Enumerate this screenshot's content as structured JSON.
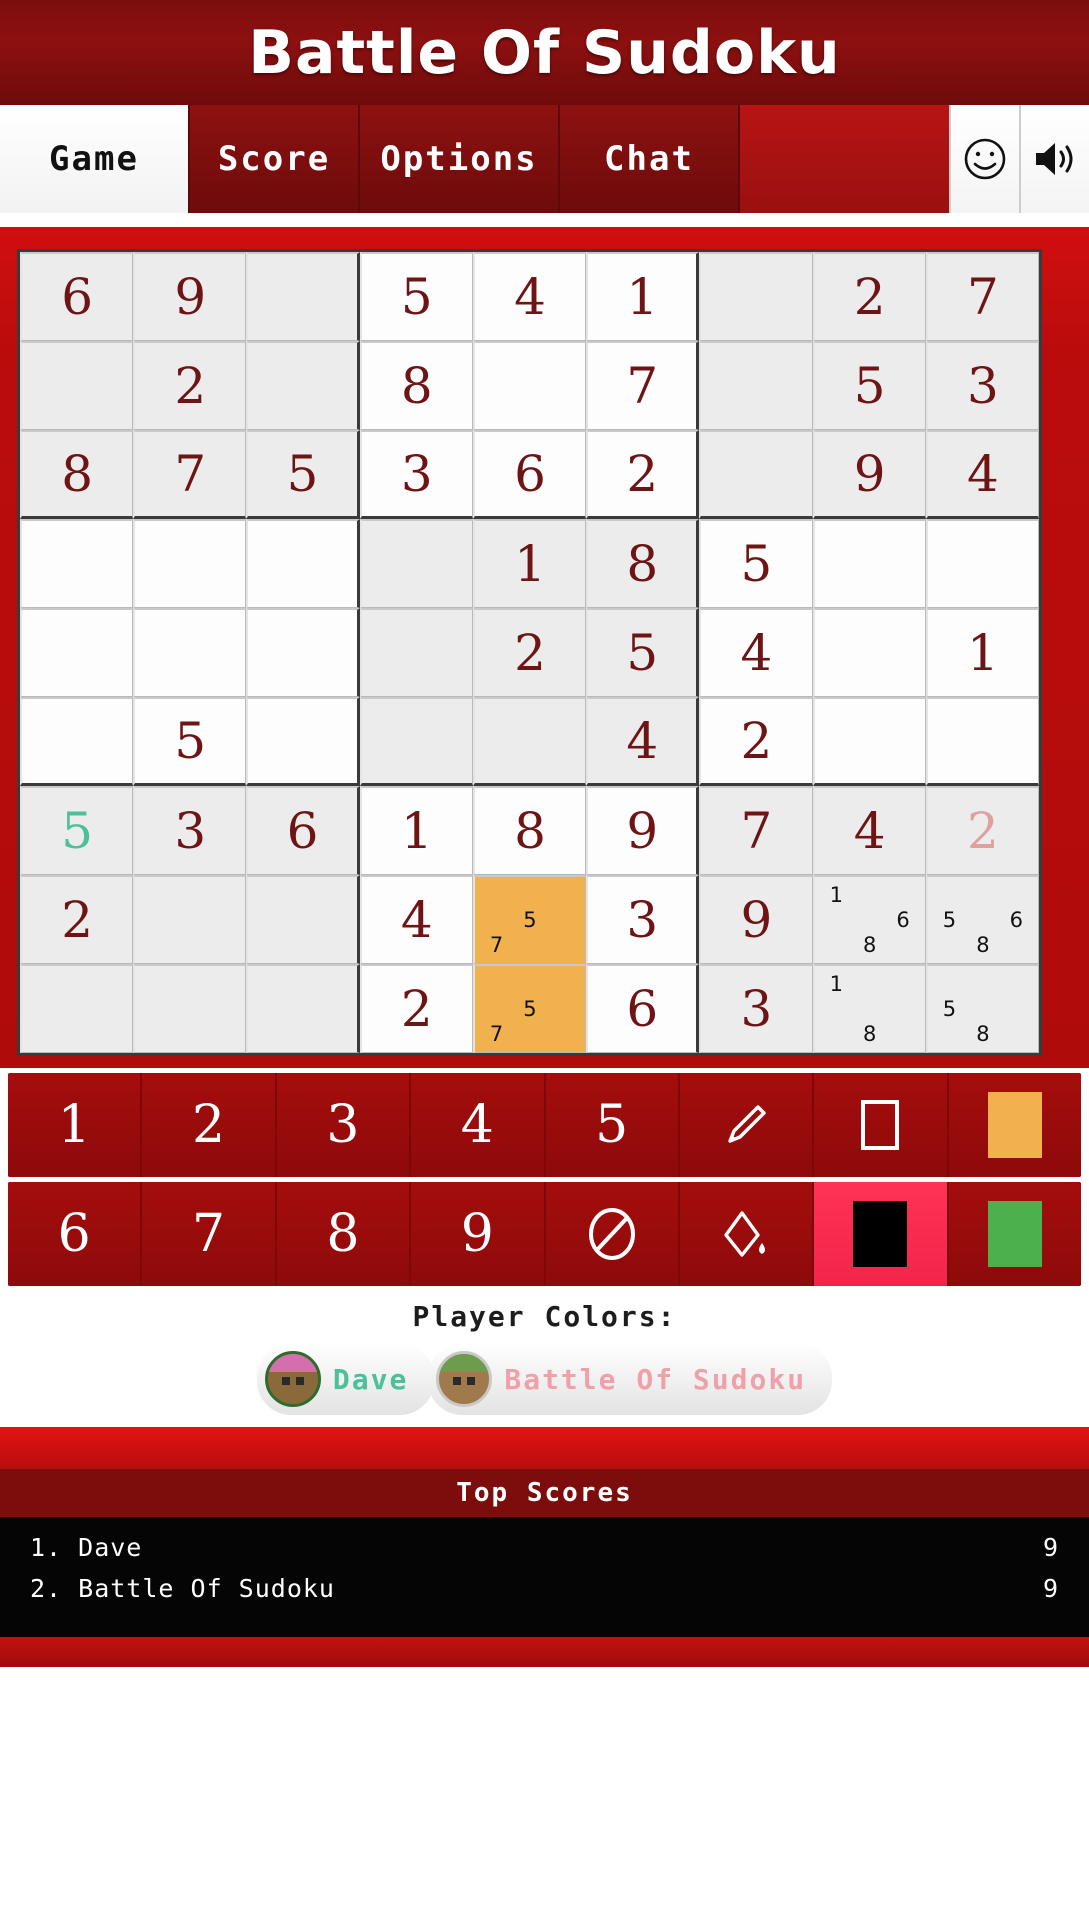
{
  "header": {
    "title": "Battle Of Sudoku"
  },
  "tabs": [
    {
      "label": "Game",
      "active": true
    },
    {
      "label": "Score",
      "active": false
    },
    {
      "label": "Options",
      "active": false
    },
    {
      "label": "Chat",
      "active": false
    }
  ],
  "tab_icons": [
    {
      "name": "smiley-icon"
    },
    {
      "name": "speaker-icon"
    }
  ],
  "board": {
    "rows": [
      [
        {
          "v": "6",
          "s": "given"
        },
        {
          "v": "9",
          "s": "given"
        },
        {
          "v": "",
          "s": "given"
        },
        {
          "v": "5",
          "s": "given"
        },
        {
          "v": "4",
          "s": "given"
        },
        {
          "v": "1",
          "s": "given"
        },
        {
          "v": "",
          "s": "given"
        },
        {
          "v": "2",
          "s": "given"
        },
        {
          "v": "7",
          "s": "given"
        }
      ],
      [
        {
          "v": "",
          "s": "given"
        },
        {
          "v": "2",
          "s": "given"
        },
        {
          "v": "",
          "s": "given"
        },
        {
          "v": "8",
          "s": "given"
        },
        {
          "v": "",
          "s": "given"
        },
        {
          "v": "7",
          "s": "given"
        },
        {
          "v": "",
          "s": "given"
        },
        {
          "v": "5",
          "s": "given"
        },
        {
          "v": "3",
          "s": "given"
        }
      ],
      [
        {
          "v": "8",
          "s": "given"
        },
        {
          "v": "7",
          "s": "given"
        },
        {
          "v": "5",
          "s": "given"
        },
        {
          "v": "3",
          "s": "given"
        },
        {
          "v": "6",
          "s": "given"
        },
        {
          "v": "2",
          "s": "given"
        },
        {
          "v": "",
          "s": "given"
        },
        {
          "v": "9",
          "s": "given"
        },
        {
          "v": "4",
          "s": "given"
        }
      ],
      [
        {
          "v": "",
          "s": "given"
        },
        {
          "v": "",
          "s": "given"
        },
        {
          "v": "",
          "s": "given"
        },
        {
          "v": "",
          "s": "given"
        },
        {
          "v": "1",
          "s": "given"
        },
        {
          "v": "8",
          "s": "given"
        },
        {
          "v": "5",
          "s": "given"
        },
        {
          "v": "",
          "s": "given"
        },
        {
          "v": "",
          "s": "given"
        }
      ],
      [
        {
          "v": "",
          "s": "given"
        },
        {
          "v": "",
          "s": "given"
        },
        {
          "v": "",
          "s": "given"
        },
        {
          "v": "",
          "s": "given"
        },
        {
          "v": "2",
          "s": "given"
        },
        {
          "v": "5",
          "s": "given"
        },
        {
          "v": "4",
          "s": "given"
        },
        {
          "v": "",
          "s": "given"
        },
        {
          "v": "1",
          "s": "given"
        }
      ],
      [
        {
          "v": "",
          "s": "given"
        },
        {
          "v": "5",
          "s": "given"
        },
        {
          "v": "",
          "s": "given"
        },
        {
          "v": "",
          "s": "given"
        },
        {
          "v": "",
          "s": "given"
        },
        {
          "v": "4",
          "s": "given"
        },
        {
          "v": "2",
          "s": "given"
        },
        {
          "v": "",
          "s": "given"
        },
        {
          "v": "",
          "s": "given"
        }
      ],
      [
        {
          "v": "5",
          "s": "p1"
        },
        {
          "v": "3",
          "s": "given"
        },
        {
          "v": "6",
          "s": "given"
        },
        {
          "v": "1",
          "s": "given"
        },
        {
          "v": "8",
          "s": "given"
        },
        {
          "v": "9",
          "s": "given"
        },
        {
          "v": "7",
          "s": "given"
        },
        {
          "v": "4",
          "s": "given"
        },
        {
          "v": "2",
          "s": "p2"
        }
      ],
      [
        {
          "v": "2",
          "s": "given"
        },
        {
          "v": "",
          "s": "given"
        },
        {
          "v": "",
          "s": "given"
        },
        {
          "v": "4",
          "s": "given"
        },
        {
          "v": "",
          "s": "given",
          "hl": true,
          "notes": [
            "",
            "",
            "",
            "",
            "5",
            "",
            "7",
            "",
            ""
          ]
        },
        {
          "v": "3",
          "s": "given"
        },
        {
          "v": "9",
          "s": "given"
        },
        {
          "v": "",
          "s": "given",
          "notes": [
            "1",
            "",
            "",
            "",
            "",
            "6",
            "",
            "8",
            ""
          ]
        },
        {
          "v": "",
          "s": "given",
          "notes": [
            "",
            "",
            "",
            "5",
            "",
            "6",
            "",
            "8",
            ""
          ]
        }
      ],
      [
        {
          "v": "",
          "s": "given"
        },
        {
          "v": "",
          "s": "given"
        },
        {
          "v": "",
          "s": "given"
        },
        {
          "v": "2",
          "s": "given"
        },
        {
          "v": "",
          "s": "given",
          "hl": true,
          "notes": [
            "",
            "",
            "",
            "",
            "5",
            "",
            "7",
            "",
            ""
          ]
        },
        {
          "v": "6",
          "s": "given"
        },
        {
          "v": "3",
          "s": "given"
        },
        {
          "v": "",
          "s": "given",
          "notes": [
            "1",
            "",
            "",
            "",
            "",
            "",
            "",
            "8",
            ""
          ]
        },
        {
          "v": "",
          "s": "given",
          "notes": [
            "",
            "",
            "",
            "5",
            "",
            "",
            "",
            "8",
            ""
          ]
        }
      ]
    ]
  },
  "pad_top": [
    {
      "label": "1",
      "kind": "num"
    },
    {
      "label": "2",
      "kind": "num"
    },
    {
      "label": "3",
      "kind": "num"
    },
    {
      "label": "4",
      "kind": "num"
    },
    {
      "label": "5",
      "kind": "num"
    },
    {
      "label": "",
      "kind": "pencil-icon"
    },
    {
      "label": "",
      "kind": "square-icon"
    },
    {
      "label": "",
      "kind": "color-orange"
    }
  ],
  "pad_bottom": [
    {
      "label": "6",
      "kind": "num"
    },
    {
      "label": "7",
      "kind": "num"
    },
    {
      "label": "8",
      "kind": "num"
    },
    {
      "label": "9",
      "kind": "num"
    },
    {
      "label": "",
      "kind": "erase-icon"
    },
    {
      "label": "",
      "kind": "fill-icon"
    },
    {
      "label": "",
      "kind": "color-black",
      "selected": true
    },
    {
      "label": "",
      "kind": "color-green"
    }
  ],
  "player_colors": {
    "title": "Player Colors:",
    "players": [
      {
        "name": "Dave",
        "color": "#4cbf9b"
      },
      {
        "name": "Battle Of Sudoku",
        "color": "#f0a0a8"
      }
    ]
  },
  "top_scores": {
    "title": "Top Scores",
    "rows": [
      {
        "rank": "1. Dave",
        "score": "9"
      },
      {
        "rank": "2. Battle Of Sudoku",
        "score": "9"
      }
    ]
  },
  "colors": {
    "brand_dark": "#7d0d0d",
    "brand": "#b00b0b",
    "highlight_orange": "#f0b14e",
    "player1": "#4cbf9b",
    "player2": "#f0a0a8",
    "digit": "#6e1414"
  }
}
